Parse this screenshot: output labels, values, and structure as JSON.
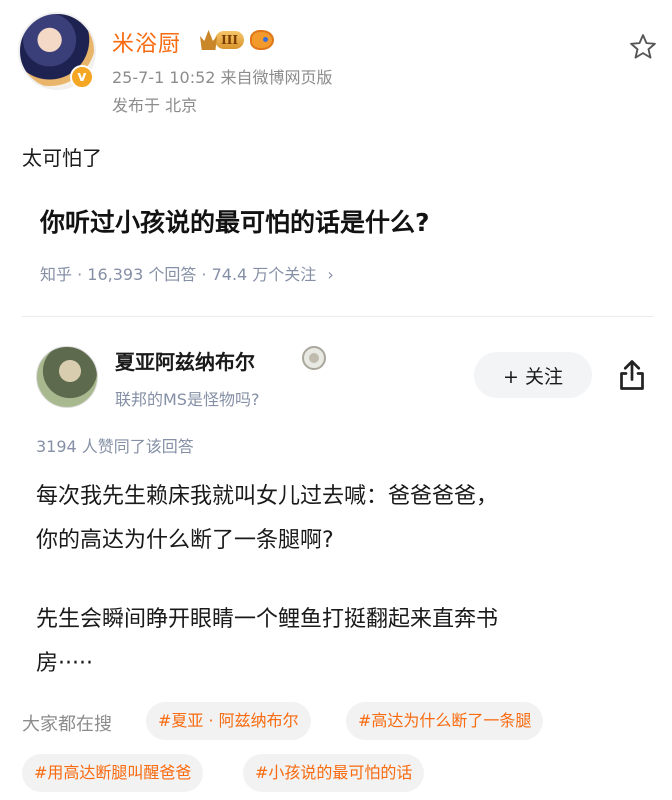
{
  "post": {
    "author": "米浴厨",
    "level": "III",
    "meta": "25-7-1 10:52  来自微博网页版",
    "location": "发布于 北京",
    "text": "太可怕了"
  },
  "question": {
    "title": "你听过小孩说的最可怕的话是什么?",
    "stats": "知乎 · 16,393 个回答 · 74.4 万个关注",
    "chevron": "›"
  },
  "answer": {
    "author": "夏亚阿兹纳布尔",
    "bio": "联邦的MS是怪物吗?",
    "follow_label": "+ 关注",
    "likes": "3194 人赞同了该回答",
    "paragraphs": [
      "每次我先生赖床我就叫女儿过去喊：爸爸爸爸，",
      "你的高达为什么断了一条腿啊?",
      "先生会瞬间睁开眼睛一个鲤鱼打挺翻起来直奔书",
      "房·····"
    ]
  },
  "search": {
    "label": "大家都在搜",
    "tags": [
      "#夏亚 · 阿兹纳布尔",
      "#高达为什么断了一条腿",
      "#用高达断腿叫醒爸爸",
      "#小孩说的最可怕的话"
    ]
  },
  "colors": {
    "accent": "#f86b10",
    "muted": "#8590a6",
    "gold": "#f5a623"
  },
  "icons": [
    "verified-icon",
    "crown-level-icon",
    "fish-icon",
    "star-icon",
    "share-icon",
    "chevron-right-icon"
  ]
}
